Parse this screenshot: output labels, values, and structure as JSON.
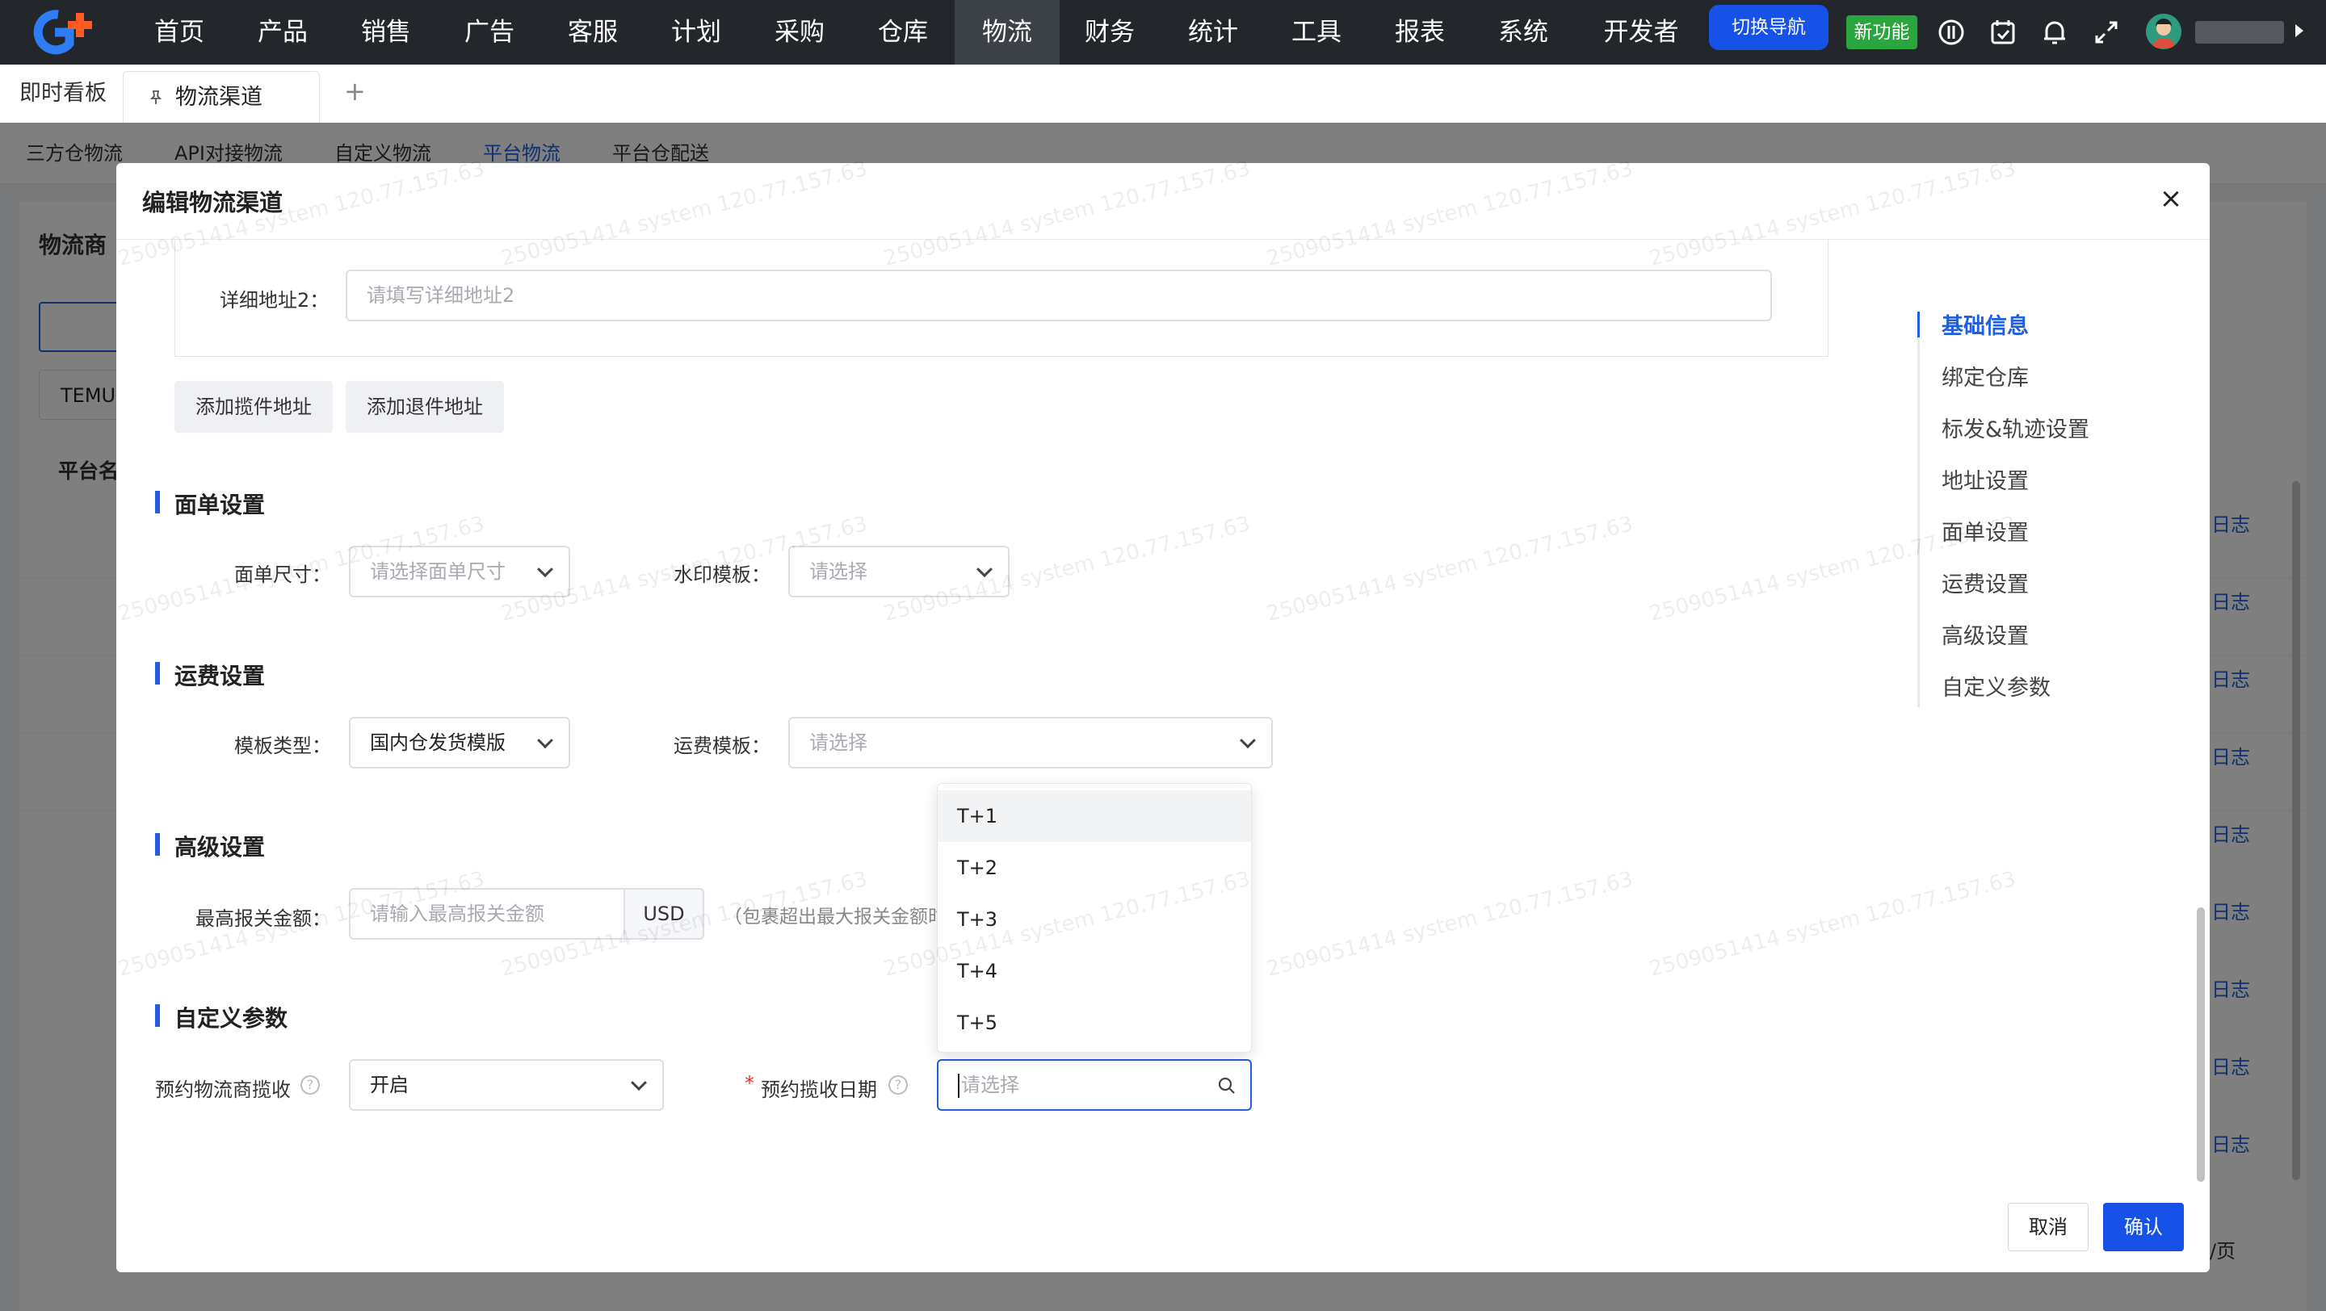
{
  "topnav": {
    "menu": [
      "首页",
      "产品",
      "销售",
      "广告",
      "客服",
      "计划",
      "采购",
      "仓库",
      "物流",
      "财务",
      "统计",
      "工具",
      "报表",
      "系统",
      "开发者"
    ],
    "active_index": 8,
    "switch_nav": "切换导航",
    "new_feature": "新功能",
    "icons": [
      "performance-icon",
      "calendar-check-icon",
      "bell-icon",
      "fullscreen-icon"
    ],
    "brand_color": "#1652e8"
  },
  "tabs": {
    "dashboard": "即时看板",
    "current": "物流渠道",
    "add": "+"
  },
  "background": {
    "subtabs": [
      "三方仓物流",
      "API对接物流",
      "自定义物流",
      "平台物流",
      "平台仓配送"
    ],
    "active_subtab": 3,
    "panel_title": "物流商",
    "filter": "TEMU",
    "table_header": "平台名",
    "log_label": "日志",
    "page_size_suffix": "/页"
  },
  "modal": {
    "title": "编辑物流渠道",
    "close": "×",
    "address2_label": "详细地址2：",
    "address2_placeholder": "请填写详细地址2",
    "add_pickup": "添加揽件地址",
    "add_return": "添加退件地址",
    "waybill": {
      "title": "面单设置",
      "size_label": "面单尺寸：",
      "size_placeholder": "请选择面单尺寸",
      "watermark_label": "水印模板：",
      "watermark_placeholder": "请选择"
    },
    "freight": {
      "title": "运费设置",
      "type_label": "模板类型：",
      "type_value": "国内仓发货模版",
      "template_label": "运费模板：",
      "template_placeholder": "请选择"
    },
    "advanced": {
      "title": "高级设置",
      "max_declare_label": "最高报关金额：",
      "max_declare_placeholder": "请输入最高报关金额",
      "currency": "USD",
      "hint": "（包裹超出最大报关金额时"
    },
    "custom": {
      "title": "自定义参数",
      "booking_label": "预约物流商揽收",
      "booking_value": "开启",
      "date_label": "预约揽收日期",
      "date_required": "*",
      "date_placeholder": "请选择"
    },
    "dropdown_options": [
      "T+1",
      "T+2",
      "T+3",
      "T+4",
      "T+5"
    ],
    "side_nav": [
      "基础信息",
      "绑定仓库",
      "标发&轨迹设置",
      "地址设置",
      "面单设置",
      "运费设置",
      "高级设置",
      "自定义参数"
    ],
    "cancel": "取消",
    "confirm": "确认"
  },
  "watermark_text": "2509051414 system 120.77.157.63"
}
